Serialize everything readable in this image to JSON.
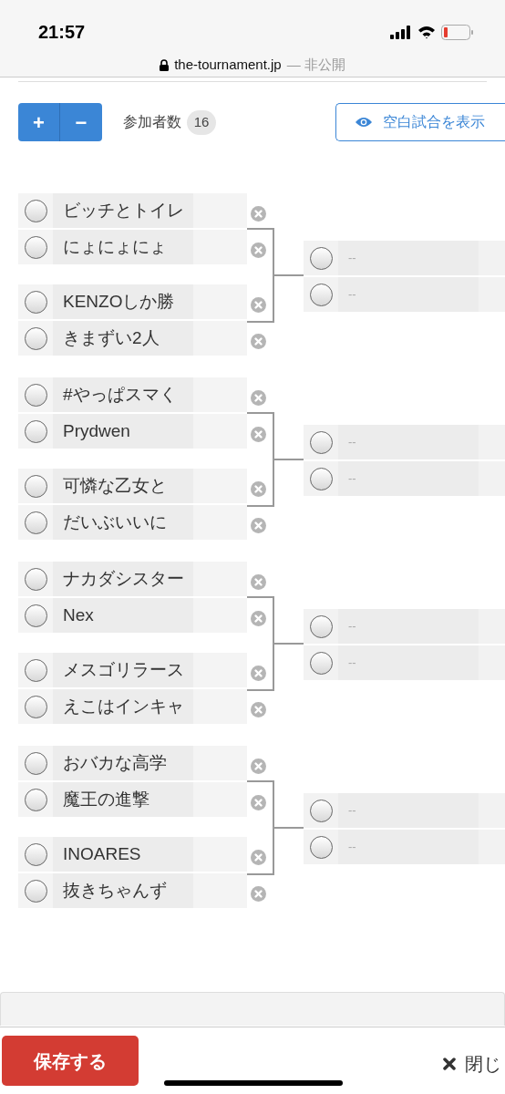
{
  "status_bar": {
    "time": "21:57",
    "url": "the-tournament.jp",
    "url_note": "— 非公開"
  },
  "toolbar": {
    "add_label": "+",
    "remove_label": "−",
    "participants_label": "参加者数",
    "participants_count": "16",
    "show_blank_label": "空白試合を表示"
  },
  "groups": [
    {
      "entrants": [
        {
          "name": "ビッチとトイレ",
          "checked": false
        },
        {
          "name": "にょにょにょ",
          "checked": false
        },
        {
          "name": "KENZOしか勝",
          "checked": false
        },
        {
          "name": "きまずい2人",
          "checked": false
        }
      ],
      "next": [
        {
          "name": "--",
          "checked": false
        },
        {
          "name": "--",
          "checked": false
        }
      ]
    },
    {
      "entrants": [
        {
          "name": "#やっぱスマく",
          "checked": false
        },
        {
          "name": "Prydwen",
          "checked": false
        },
        {
          "name": "可憐な乙女と",
          "checked": false
        },
        {
          "name": "だいぶいいに",
          "checked": false
        }
      ],
      "next": [
        {
          "name": "--",
          "checked": false
        },
        {
          "name": "--",
          "checked": false
        }
      ]
    },
    {
      "entrants": [
        {
          "name": "ナカダシスター",
          "checked": false
        },
        {
          "name": "Nex",
          "checked": false
        },
        {
          "name": "メスゴリラース",
          "checked": false
        },
        {
          "name": "えこはインキャ",
          "checked": false
        }
      ],
      "next": [
        {
          "name": "--",
          "checked": false
        },
        {
          "name": "--",
          "checked": false
        }
      ]
    },
    {
      "entrants": [
        {
          "name": "おバカな高学",
          "checked": false
        },
        {
          "name": "魔王の進撃",
          "checked": false
        },
        {
          "name": "INOARES",
          "checked": false
        },
        {
          "name": "抜きちゃんず",
          "checked": false
        }
      ],
      "next": [
        {
          "name": "--",
          "checked": false
        },
        {
          "name": "--",
          "checked": false
        }
      ]
    }
  ],
  "footer": {
    "save_label": "保存する",
    "close_label": "閉じ"
  }
}
